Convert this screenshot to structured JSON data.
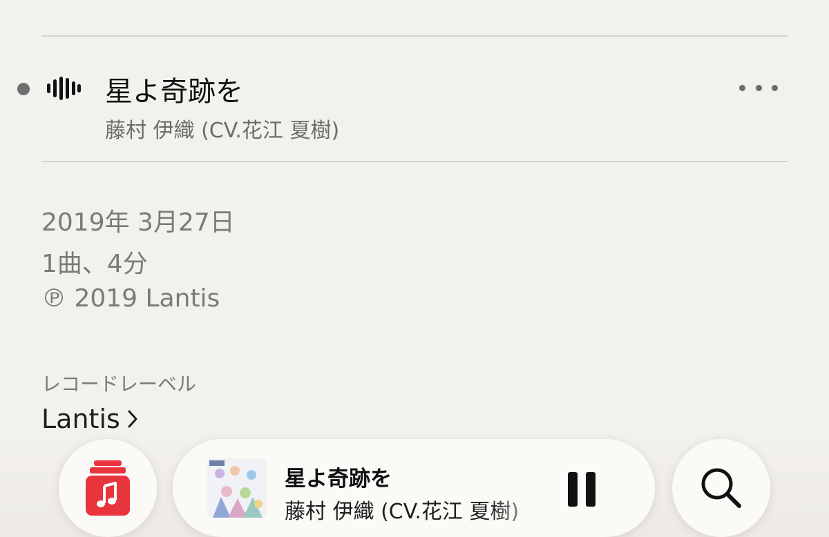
{
  "track": {
    "title": "星よ奇跡を",
    "artist": "藤村 伊織 (CV.花江 夏樹)"
  },
  "album_info": {
    "release_date": "2019年 3月27日",
    "summary": "1曲、4分",
    "copyright": "℗ 2019 Lantis"
  },
  "record_label": {
    "heading": "レコードレーベル",
    "name": "Lantis"
  },
  "mini_player": {
    "title": "星よ奇跡を",
    "artist": "藤村 伊織 (CV.花江 夏樹)"
  },
  "colors": {
    "background": "#f3f1ed",
    "library_red": "#e8343c",
    "secondary_text": "#7b7a77"
  },
  "icons": {
    "now_playing": "waveform-icon",
    "more": "ellipsis-icon",
    "label_link": "chevron-right-icon",
    "library": "music-library-icon",
    "playback": "pause-icon",
    "search": "search-icon"
  }
}
